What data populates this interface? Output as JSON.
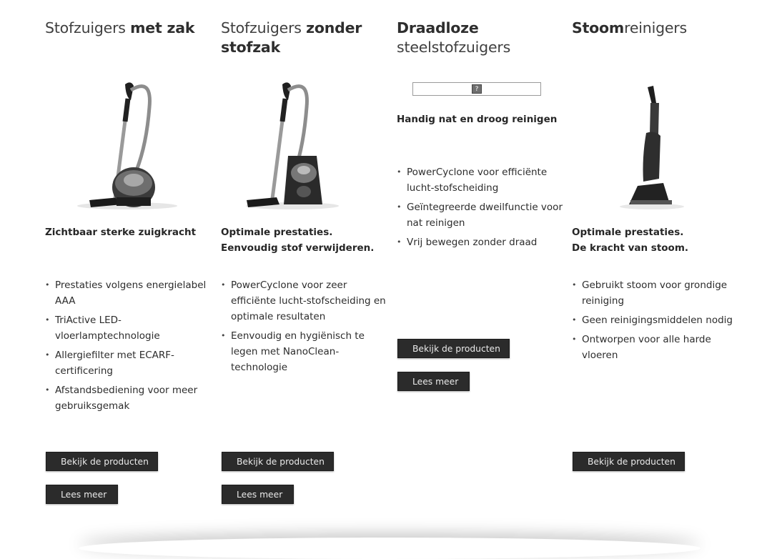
{
  "columns": [
    {
      "title_regular": "Stofzuigers ",
      "title_bold": "met zak",
      "image_icon": "bagged-vacuum-cleaner-icon",
      "headline_lines": [
        "Zichtbaar sterke zuigkracht"
      ],
      "features": [
        "Prestaties volgens energielabel AAA",
        "TriActive LED-vloerlamptechnologie",
        "Allergiefilter met ECARF-certificering",
        "Afstandsbediening voor meer gebruiksgemak"
      ],
      "buttons": [
        "Bekijk de producten",
        "Lees meer"
      ]
    },
    {
      "title_regular": "Stofzuigers ",
      "title_bold": "zonder stofzak",
      "image_icon": "bagless-vacuum-cleaner-icon",
      "headline_lines": [
        "Optimale prestaties.",
        "Eenvoudig stof verwijderen."
      ],
      "features": [
        "PowerCyclone voor zeer efficiënte lucht-stofscheiding en optimale resultaten",
        "Eenvoudig en hygiënisch te legen met NanoClean-technologie"
      ],
      "buttons": [
        "Bekijk de producten",
        "Lees meer"
      ]
    },
    {
      "title_bold": "Draadloze",
      "title_regular": "steelstofzuigers",
      "image_icon": "broken-image-icon",
      "broken_glyph": "?",
      "headline_lines": [
        "Handig nat en droog reinigen"
      ],
      "features": [
        "PowerCyclone voor efficiënte lucht-stofscheiding",
        "Geïntegreerde dweilfunctie voor nat reinigen",
        "Vrij bewegen zonder draad"
      ],
      "buttons": [
        "Bekijk de producten",
        "Lees meer"
      ]
    },
    {
      "title_bold": "Stoom",
      "title_regular": "reinigers",
      "image_icon": "steam-cleaner-icon",
      "headline_lines": [
        "Optimale prestaties.",
        "De kracht van stoom."
      ],
      "features": [
        "Gebruikt stoom voor grondige reiniging",
        "Geen reinigingsmiddelen nodig",
        "Ontworpen voor alle harde vloeren"
      ],
      "buttons": [
        "Bekijk de producten"
      ]
    }
  ],
  "colors": {
    "button_bg": "#2b2b2b",
    "button_text": "#eaeaea",
    "text": "#2a2a2a"
  }
}
